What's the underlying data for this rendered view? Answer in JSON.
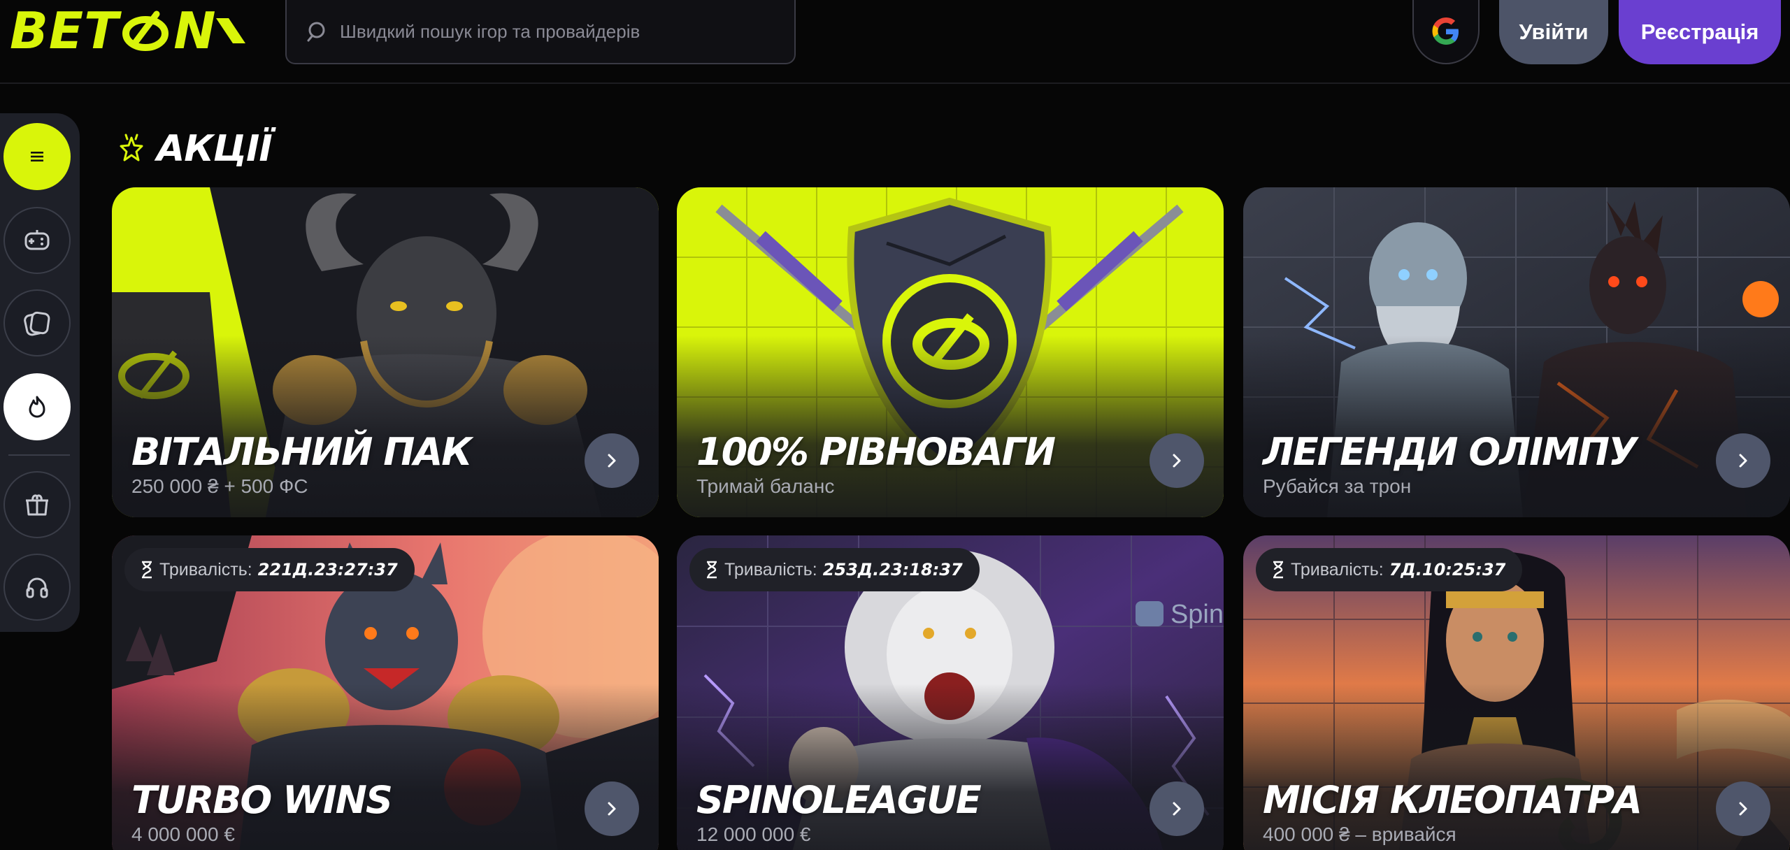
{
  "brand": {
    "logo_text_left": "BET",
    "logo_text_right": "N",
    "accent": "#d9f50a",
    "primary": "#6a3fd0"
  },
  "search": {
    "placeholder": "Швидкий пошук ігор та провайдерів"
  },
  "auth": {
    "login_label": "Увійти",
    "register_label": "Реєстрація",
    "google_icon": "google-icon"
  },
  "sidebar": {
    "items": [
      {
        "icon": "menu-icon",
        "active": false
      },
      {
        "icon": "gamepad-icon",
        "active": false
      },
      {
        "icon": "cards-icon",
        "active": false
      },
      {
        "icon": "fire-icon",
        "active": true
      },
      {
        "icon": "gift-shop-icon",
        "active": false
      },
      {
        "icon": "support-headset-icon",
        "active": false
      }
    ]
  },
  "section": {
    "title": "АКЦІЇ",
    "icon": "promo-star-icon"
  },
  "promotions": [
    {
      "title": "ВІТАЛЬНИЙ ПАК",
      "subtitle": "250 000 ₴ + 500 ФС"
    },
    {
      "title": "100% РІВНОВАГИ",
      "subtitle": "Тримай баланс"
    },
    {
      "title": "ЛЕГЕНДИ ОЛІМПУ",
      "subtitle": "Рубайся за трон"
    },
    {
      "title": "TURBO WINS",
      "subtitle": "4 000 000 €",
      "timer_label": "Тривалість:",
      "timer_value": "221Д.23:27:37"
    },
    {
      "title": "SPINOLEAGUE",
      "subtitle": "12 000 000 €",
      "timer_label": "Тривалість:",
      "timer_value": "253Д.23:18:37",
      "provider_logo_text": "Spin"
    },
    {
      "title": "МІСІЯ КЛЕОПАТРА",
      "subtitle": "400 000 ₴ – вривайся",
      "timer_label": "Тривалість:",
      "timer_value": "7Д.10:25:37"
    }
  ]
}
